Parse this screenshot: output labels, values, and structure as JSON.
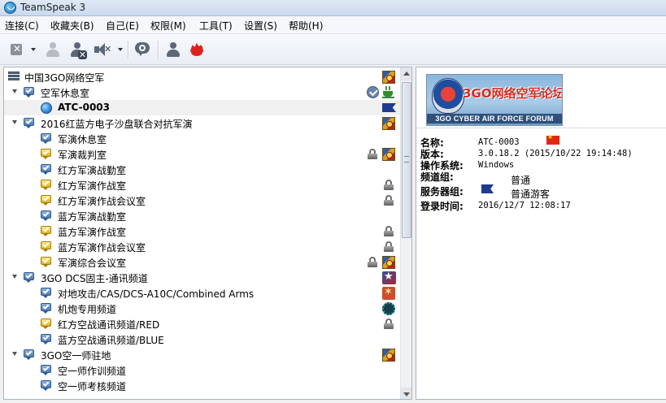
{
  "window": {
    "title": "TeamSpeak 3"
  },
  "menu": [
    "连接(C)",
    "收藏夹(B)",
    "自己(E)",
    "权限(M)",
    "工具(T)",
    "设置(S)",
    "帮助(H)"
  ],
  "tree": {
    "server": "中国3GO网络空军",
    "rows": [
      {
        "label": "空军休息室"
      },
      {
        "label": "ATC-0003"
      },
      {
        "label": "2016红蓝方电子沙盘联合对抗军演"
      },
      {
        "label": "军演休息室"
      },
      {
        "label": "军演裁判室"
      },
      {
        "label": "红方军演战勤室"
      },
      {
        "label": "红方军演作战室"
      },
      {
        "label": "红方军演作战会议室"
      },
      {
        "label": "蓝方军演战勤室"
      },
      {
        "label": "蓝方军演作战室"
      },
      {
        "label": "蓝方军演作战会议室"
      },
      {
        "label": "军演综合会议室"
      },
      {
        "label": "3GO DCS固主-通讯频道"
      },
      {
        "label": "对地攻击/CAS/DCS-A10C/Combined Arms"
      },
      {
        "label": "机炮专用频道"
      },
      {
        "label": "红方空战通讯频道/RED"
      },
      {
        "label": "蓝方空战通讯频道/BLUE"
      },
      {
        "label": "3GO空一师驻地"
      },
      {
        "label": "空一师作训频道"
      },
      {
        "label": "空一师考核频道"
      }
    ]
  },
  "banner": {
    "cn_title": "3GO网络空军论坛",
    "en_title": "3GO CYBER AIR FORCE FORUM"
  },
  "info": {
    "name_label": "名称:",
    "name_value": "ATC-0003",
    "version_label": "版本:",
    "version_value": "3.0.18.2 (2015/10/22 19:14:48)",
    "os_label": "操作系统:",
    "os_value": "Windows",
    "channel_group_label": "频道组:",
    "channel_group_value": "普通",
    "server_group_label": "服务器组:",
    "server_group_value": "普通游客",
    "login_time_label": "登录时间:",
    "login_time_value": "2016/12/7 12:08:17"
  }
}
